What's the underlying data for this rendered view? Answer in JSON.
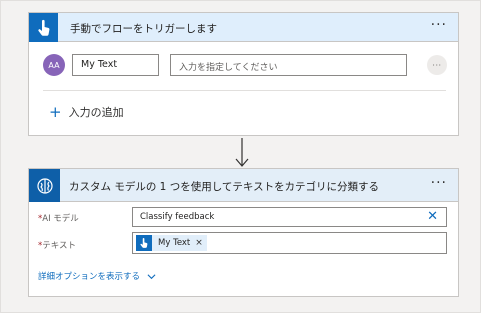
{
  "trigger_card": {
    "title": "手動でフローをトリガーします",
    "more_label": "···",
    "avatar_text": "AA",
    "input_name_value": "My Text",
    "input_desc_placeholder": "入力を指定してください",
    "row_more_label": "···",
    "add_input_label": "入力の追加"
  },
  "action_card": {
    "title": "カスタム モデルの 1 つを使用してテキストをカテゴリに分類する",
    "more_label": "···",
    "ai_model_label": "AI モデル",
    "ai_model_value": "Classify feedback",
    "text_label": "テキスト",
    "required_mark": "*",
    "token_label": "My Text",
    "token_remove": "×",
    "clear_label": "✕",
    "advanced_options_label": "詳細オプションを表示する"
  },
  "colors": {
    "accent": "#0f6cbd",
    "header_bg": "#deecf9",
    "avatar_bg": "#8764b8",
    "required": "#a4262c"
  },
  "icons": [
    "hand-touch-icon",
    "ai-brain-icon",
    "down-arrow-icon",
    "plus-icon",
    "chevron-down-icon",
    "close-icon"
  ]
}
